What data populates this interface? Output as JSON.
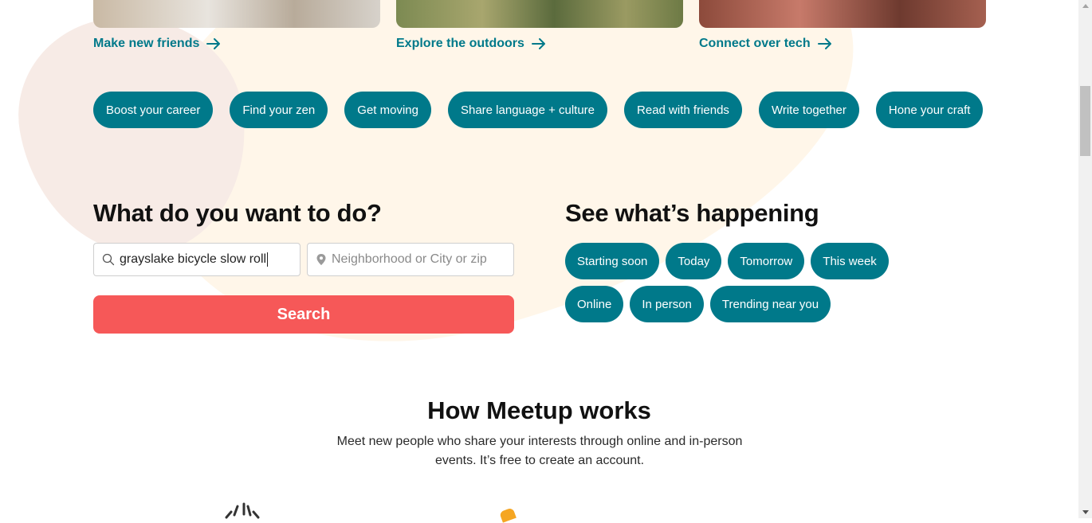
{
  "featured_cards": [
    {
      "link_label": "Make new friends"
    },
    {
      "link_label": "Explore the outdoors"
    },
    {
      "link_label": "Connect over tech"
    }
  ],
  "topics": [
    "Boost your career",
    "Find your zen",
    "Get moving",
    "Share language + culture",
    "Read with friends",
    "Write together",
    "Hone your craft"
  ],
  "search_section": {
    "heading": "What do you want to do?",
    "keyword_value": "grayslake bicycle slow roll",
    "location_placeholder": "Neighborhood or City or zip",
    "button_label": "Search"
  },
  "happening_section": {
    "heading": "See what’s happening",
    "row1": [
      "Starting soon",
      "Today",
      "Tomorrow",
      "This week"
    ],
    "row2": [
      "Online",
      "In person",
      "Trending near you"
    ]
  },
  "how_section": {
    "title": "How Meetup works",
    "subtitle": "Meet new people who share your interests through online and in-person events. It’s free to create an account."
  },
  "colors": {
    "teal": "#00798a",
    "coral": "#f65858",
    "cream_blob": "#fff6e9",
    "pink_blob": "#f7ebe6"
  }
}
